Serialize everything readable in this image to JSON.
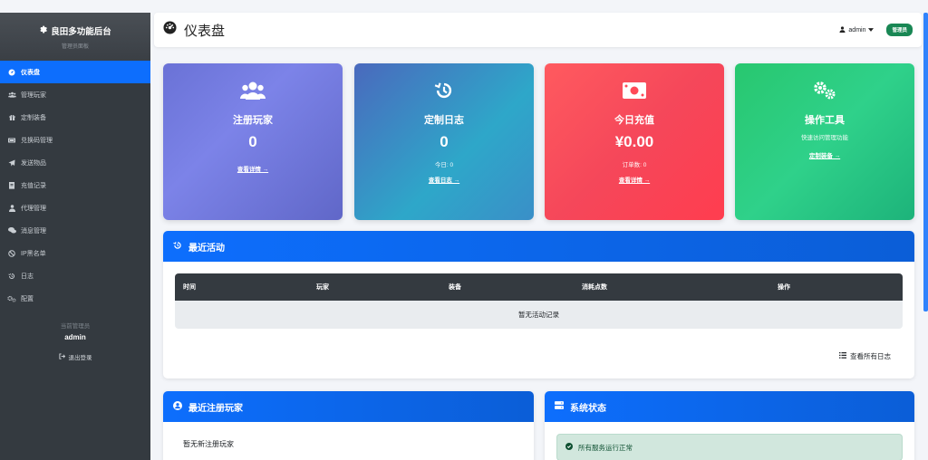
{
  "sidebar": {
    "brand_title": "良田多功能后台",
    "brand_subtitle": "管理员面板",
    "items": [
      {
        "label": "仪表盘",
        "icon": "dashboard-icon"
      },
      {
        "label": "管理玩家",
        "icon": "users-icon"
      },
      {
        "label": "定制装备",
        "icon": "gift-icon"
      },
      {
        "label": "兑换码管理",
        "icon": "ticket-icon"
      },
      {
        "label": "发送物品",
        "icon": "paper-plane-icon"
      },
      {
        "label": "充值记录",
        "icon": "receipt-icon"
      },
      {
        "label": "代理管理",
        "icon": "user-tie-icon"
      },
      {
        "label": "消息管理",
        "icon": "comments-icon"
      },
      {
        "label": "IP黑名单",
        "icon": "ban-icon"
      },
      {
        "label": "日志",
        "icon": "history-icon"
      },
      {
        "label": "配置",
        "icon": "cogs-icon"
      }
    ],
    "current_admin_label": "当前管理员",
    "current_admin": "admin",
    "logout_label": "退出登录"
  },
  "header": {
    "title": "仪表盘",
    "user": "admin",
    "role_badge": "管理员"
  },
  "stats": [
    {
      "title": "注册玩家",
      "value": "0",
      "sub": "",
      "link": "查看详情 →",
      "icon": "users-icon"
    },
    {
      "title": "定制日志",
      "value": "0",
      "sub": "今日: 0",
      "link": "查看日志 →",
      "icon": "history-icon"
    },
    {
      "title": "今日充值",
      "value": "¥0.00",
      "sub": "订单数: 0",
      "link": "查看详情 →",
      "icon": "money-bill-icon"
    },
    {
      "title": "操作工具",
      "value": "",
      "sub": "快速访问管理功能",
      "link": "定制装备 →",
      "icon": "cogs-icon"
    }
  ],
  "activity": {
    "title": "最近活动",
    "columns": [
      "时间",
      "玩家",
      "装备",
      "消耗点数",
      "操作"
    ],
    "empty": "暂无活动记录",
    "view_all": "查看所有日志"
  },
  "players": {
    "title": "最近注册玩家",
    "empty": "暂无新注册玩家"
  },
  "system": {
    "title": "系统状态",
    "status": "所有服务运行正常"
  },
  "colors": {
    "primary": "#0d6efd",
    "sidebar": "#343a40",
    "success": "#198754"
  }
}
